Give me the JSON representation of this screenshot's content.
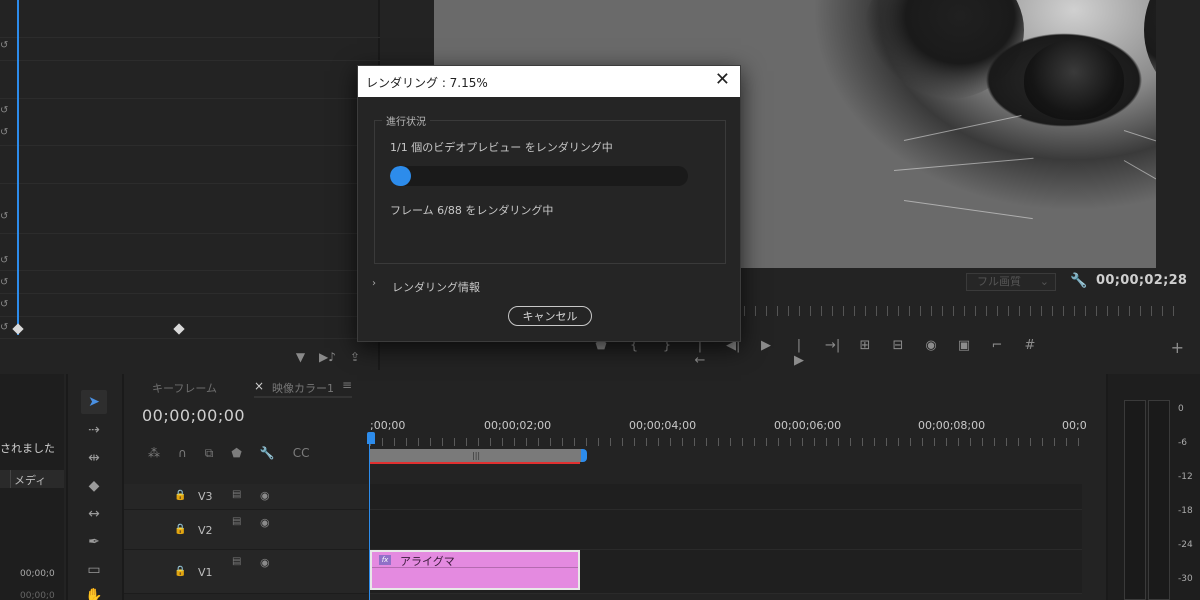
{
  "dialog": {
    "title": "レンダリング : 7.15%",
    "close_icon": "close-icon",
    "group_label": "進行状況",
    "status_line": "1/1 個のビデオプレビュー をレンダリング中",
    "progress_percent": 7.15,
    "frame_status": "フレーム  6/88 をレンダリング中",
    "disclosure_label": "レンダリング情報",
    "cancel_label": "キャンセル"
  },
  "monitor": {
    "quality_select": "フル画質",
    "timecode": "00;00;02;28"
  },
  "project_panel": {
    "message": "されました",
    "column_header": "メディ",
    "timecode": "00;00;0",
    "timecode2": "00;00;0"
  },
  "timeline": {
    "tab_keyframe": "キーフレーム",
    "tab_close": "×",
    "tab_sequence": "映像カラー1",
    "timecode": "00;00;00;00",
    "ruler_labels": [
      ";00;00",
      "00;00;02;00",
      "00;00;04;00",
      "00;00;06;00",
      "00;00;08;00",
      "00;0"
    ],
    "tracks": [
      {
        "name": "V3"
      },
      {
        "name": "V2"
      },
      {
        "name": "V1"
      }
    ],
    "clip": {
      "name": "アライグマ",
      "fx_badge": "fx",
      "color": "#e48ae0"
    }
  },
  "meter": {
    "db_labels": [
      "0",
      "-6",
      "-12",
      "-18",
      "-24",
      "-30"
    ]
  },
  "colors": {
    "accent": "#2d8ceb",
    "render_bar": "#e03030",
    "clip": "#e48ae0"
  }
}
